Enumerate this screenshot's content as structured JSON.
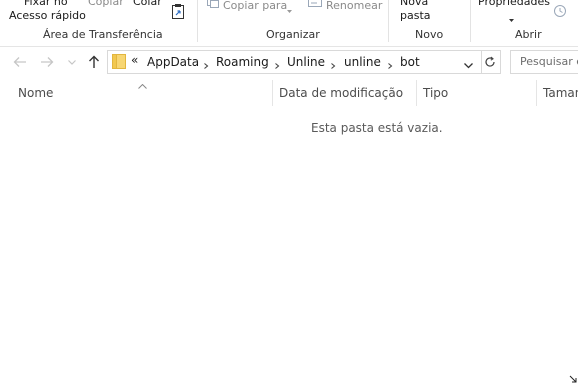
{
  "ribbon": {
    "pin_line1": "Fixar no",
    "pin_line2": "Acesso rápido",
    "copy": "Copiar",
    "paste": "Colar",
    "copy_to": "Copiar para",
    "rename": "Renomear",
    "new_folder_line1": "Nova",
    "new_folder_line2": "pasta",
    "properties": "Propriedades",
    "groups": {
      "clipboard": "Área de Transferência",
      "organize": "Organizar",
      "new": "Novo",
      "open": "Abrir"
    }
  },
  "address": {
    "overflow": "«",
    "path": [
      "AppData",
      "Roaming",
      "Unline",
      "unline",
      "bot"
    ]
  },
  "search": {
    "placeholder": "Pesquisar em"
  },
  "columns": {
    "name": "Nome",
    "modified": "Data de modificação",
    "type": "Tipo",
    "size": "Taman"
  },
  "empty_message": "Esta pasta está vazia.",
  "colors": {
    "border": "#d9d9d9",
    "folder": "#f7d673",
    "text": "#1a1a1a",
    "muted": "#8a8a8a"
  }
}
